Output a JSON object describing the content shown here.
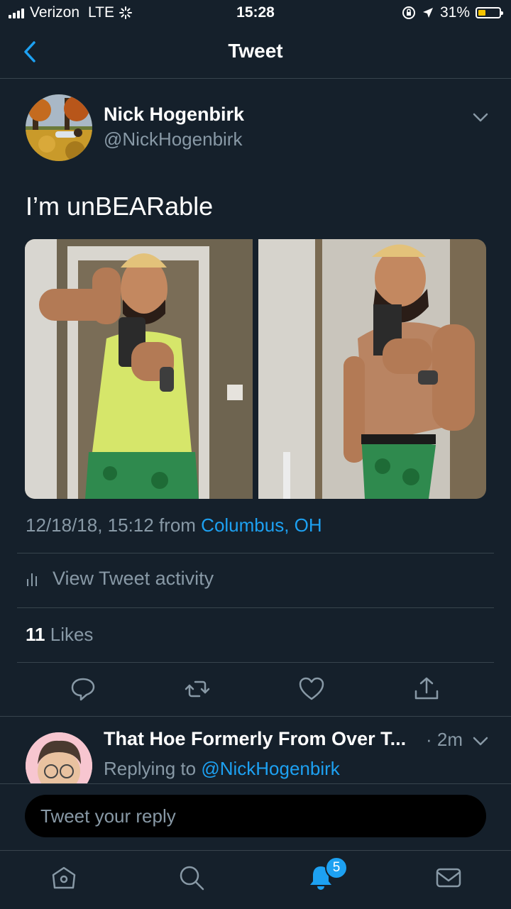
{
  "status_bar": {
    "carrier": "Verizon",
    "network": "LTE",
    "time": "15:28",
    "battery": "31%",
    "battery_level": 0.31
  },
  "nav": {
    "title": "Tweet"
  },
  "tweet": {
    "author_name": "Nick Hogenbirk",
    "author_handle": "@NickHogenbirk",
    "text": "I’m unBEARable",
    "date": "12/18/18, 15:12 from ",
    "location": "Columbus, OH",
    "activity_label": "View Tweet activity",
    "likes_count": "11",
    "likes_label": "Likes"
  },
  "reply": {
    "author_name": "That Hoe Formerly From Over T...",
    "time": "· 2m",
    "replying_prefix": "Replying to ",
    "replying_handle": "@NickHogenbirk"
  },
  "composer": {
    "placeholder": "Tweet your reply"
  },
  "tabbar": {
    "notifications_badge": "5"
  },
  "colors": {
    "background": "#15202b",
    "accent": "#1da1f2",
    "secondary_text": "#8899a6",
    "divider": "#38444d"
  }
}
